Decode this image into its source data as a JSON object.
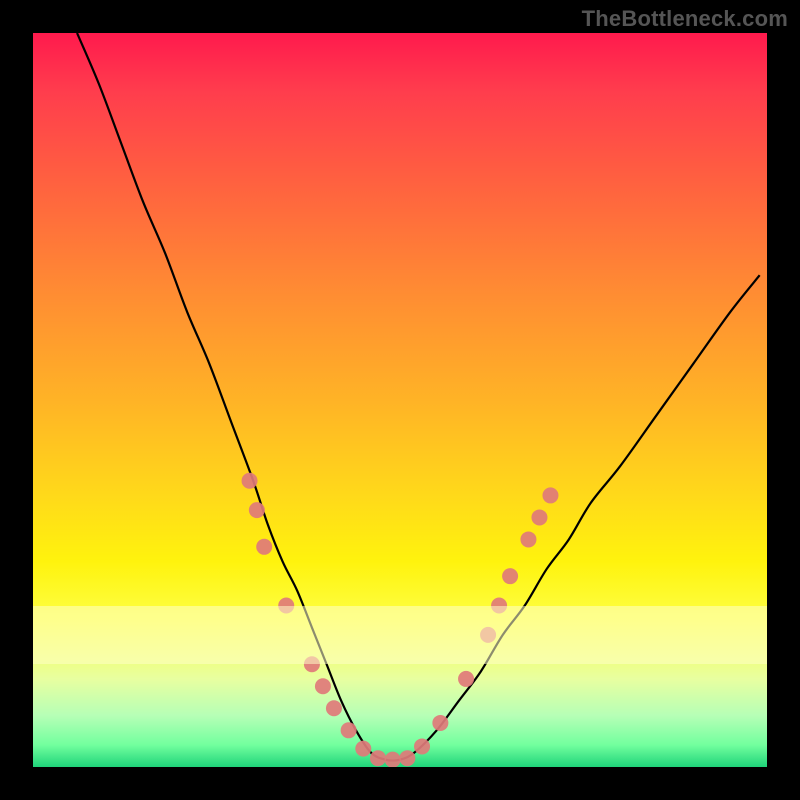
{
  "watermark": "TheBottleneck.com",
  "chart_data": {
    "type": "line",
    "title": "",
    "xlabel": "",
    "ylabel": "",
    "ylim": [
      0,
      100
    ],
    "xlim": [
      0,
      100
    ],
    "series": [
      {
        "name": "curve",
        "x": [
          6,
          9,
          12,
          15,
          18,
          21,
          24,
          27,
          30,
          32,
          34,
          36,
          38,
          40,
          42,
          44,
          46,
          48,
          50,
          52,
          55,
          58,
          61,
          64,
          67,
          70,
          73,
          76,
          80,
          85,
          90,
          95,
          99
        ],
        "y": [
          100,
          93,
          85,
          77,
          70,
          62,
          55,
          47,
          39,
          33,
          28,
          24,
          19,
          14,
          9,
          5,
          2,
          1,
          1,
          2,
          5,
          9,
          13,
          18,
          22,
          27,
          31,
          36,
          41,
          48,
          55,
          62,
          67
        ],
        "stroke": "#000000",
        "stroke_width": 2.2
      }
    ],
    "markers": [
      {
        "x": 29.5,
        "y": 39,
        "r": 8,
        "fill": "#e07a7a"
      },
      {
        "x": 30.5,
        "y": 35,
        "r": 8,
        "fill": "#e07a7a"
      },
      {
        "x": 31.5,
        "y": 30,
        "r": 8,
        "fill": "#e07a7a"
      },
      {
        "x": 34.5,
        "y": 22,
        "r": 8,
        "fill": "#e07a7a"
      },
      {
        "x": 38.0,
        "y": 14,
        "r": 8,
        "fill": "#e07a7a"
      },
      {
        "x": 39.5,
        "y": 11,
        "r": 8,
        "fill": "#e07a7a"
      },
      {
        "x": 41.0,
        "y": 8,
        "r": 8,
        "fill": "#e07a7a"
      },
      {
        "x": 43.0,
        "y": 5,
        "r": 8,
        "fill": "#e07a7a"
      },
      {
        "x": 45.0,
        "y": 2.5,
        "r": 8,
        "fill": "#e07a7a"
      },
      {
        "x": 47.0,
        "y": 1.2,
        "r": 8,
        "fill": "#e07a7a"
      },
      {
        "x": 49.0,
        "y": 1.0,
        "r": 8,
        "fill": "#e07a7a"
      },
      {
        "x": 51.0,
        "y": 1.2,
        "r": 8,
        "fill": "#e07a7a"
      },
      {
        "x": 53.0,
        "y": 2.8,
        "r": 8,
        "fill": "#e07a7a"
      },
      {
        "x": 55.5,
        "y": 6,
        "r": 8,
        "fill": "#e07a7a"
      },
      {
        "x": 59.0,
        "y": 12,
        "r": 8,
        "fill": "#e07a7a"
      },
      {
        "x": 62.0,
        "y": 18,
        "r": 8,
        "fill": "#e07a7a"
      },
      {
        "x": 63.5,
        "y": 22,
        "r": 8,
        "fill": "#e07a7a"
      },
      {
        "x": 65.0,
        "y": 26,
        "r": 8,
        "fill": "#e07a7a"
      },
      {
        "x": 67.5,
        "y": 31,
        "r": 8,
        "fill": "#e07a7a"
      },
      {
        "x": 69.0,
        "y": 34,
        "r": 8,
        "fill": "#e07a7a"
      },
      {
        "x": 70.5,
        "y": 37,
        "r": 8,
        "fill": "#e07a7a"
      }
    ]
  }
}
